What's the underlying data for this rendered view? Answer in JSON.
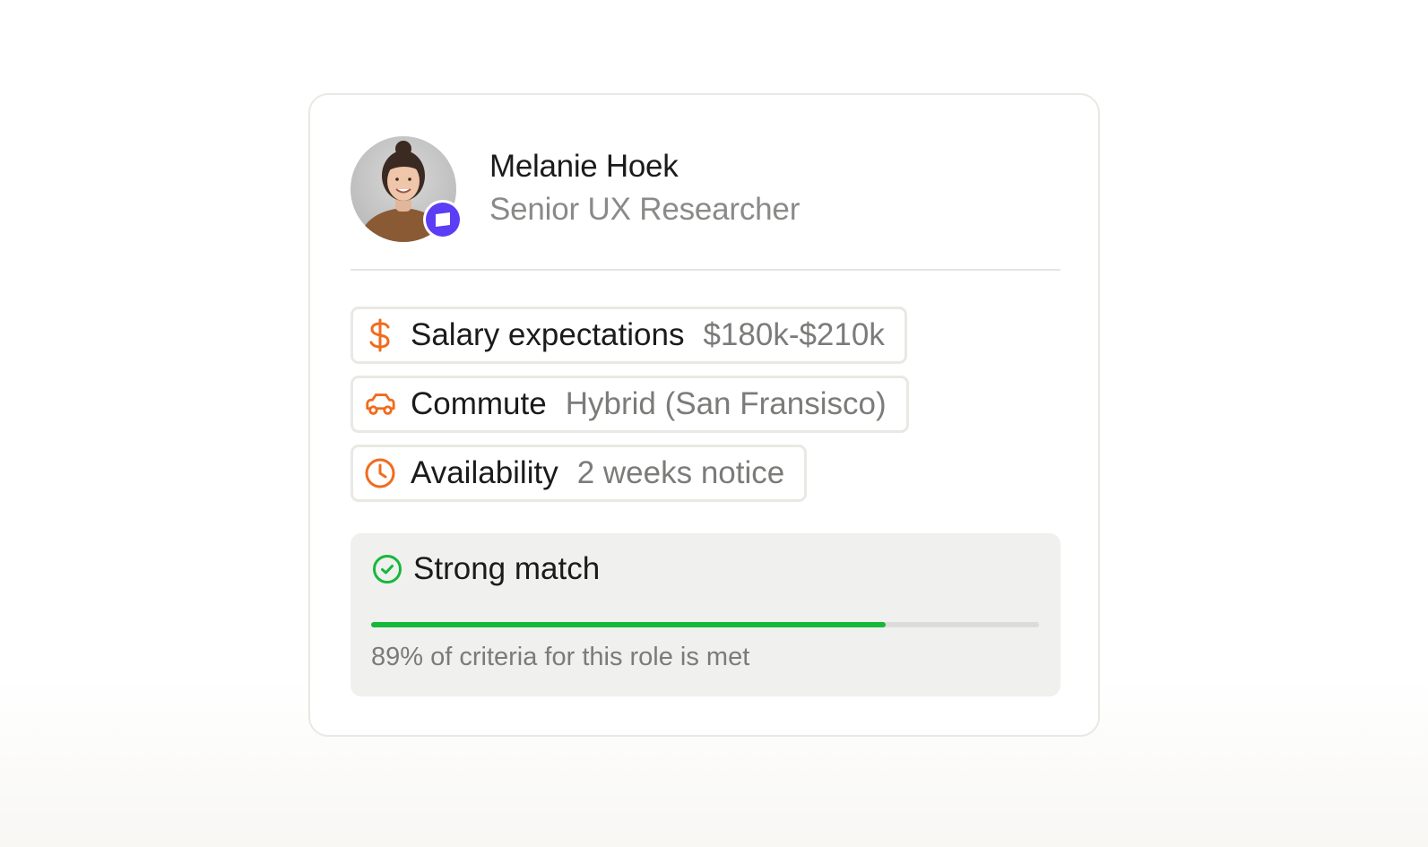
{
  "candidate": {
    "name": "Melanie Hoek",
    "role": "Senior UX Researcher"
  },
  "details": [
    {
      "icon": "dollar-icon",
      "label": "Salary expectations",
      "value": "$180k-$210k"
    },
    {
      "icon": "car-icon",
      "label": "Commute",
      "value": "Hybrid (San Fransisco)"
    },
    {
      "icon": "clock-icon",
      "label": "Availability",
      "value": "2 weeks notice"
    }
  ],
  "match": {
    "icon": "check-circle-icon",
    "title": "Strong match",
    "progress_fraction": 0.77,
    "description": "89% of criteria for this role is met"
  },
  "colors": {
    "accent_orange": "#f26b1d",
    "match_green": "#16b83c",
    "badge_purple": "#5b3df5"
  }
}
